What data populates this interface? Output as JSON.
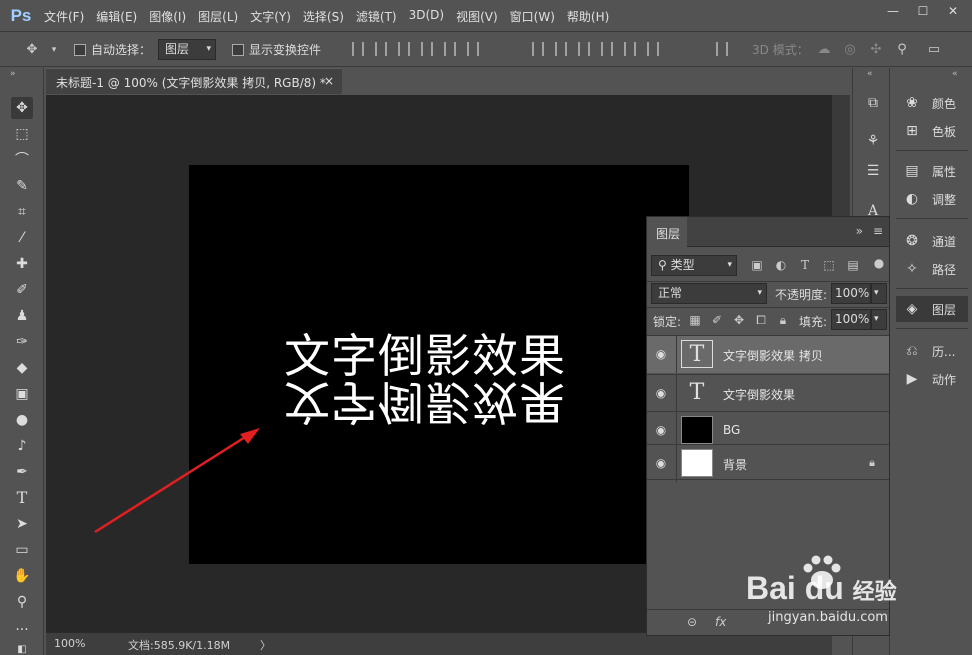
{
  "app": {
    "logo": "Ps"
  },
  "menus": [
    "文件(F)",
    "编辑(E)",
    "图像(I)",
    "图层(L)",
    "文字(Y)",
    "选择(S)",
    "滤镜(T)",
    "3D(D)",
    "视图(V)",
    "窗口(W)",
    "帮助(H)"
  ],
  "window_controls": {
    "minimize": "—",
    "maximize": "☐",
    "close": "✕"
  },
  "options": {
    "auto_select_label": "自动选择：",
    "auto_select_value": "图层",
    "show_transform_label": "显示变换控件",
    "mode_3d_label": "3D 模式："
  },
  "document": {
    "tab_title": "未标题-1 @ 100% (文字倒影效果 拷贝, RGB/8) *",
    "close": "×",
    "canvas_text": "文字倒影效果",
    "reflection_text": "文字倒影效果"
  },
  "status": {
    "zoom": "100%",
    "doc_info": "文档:585.9K/1.18M",
    "arrow": "〉"
  },
  "side_panels": [
    {
      "icon": "palette-icon",
      "label": "颜色"
    },
    {
      "icon": "swatches-icon",
      "label": "色板"
    },
    {
      "icon": "properties-icon",
      "label": "属性"
    },
    {
      "icon": "adjustments-icon",
      "label": "调整"
    },
    {
      "icon": "channels-icon",
      "label": "通道"
    },
    {
      "icon": "paths-icon",
      "label": "路径"
    },
    {
      "icon": "layers-icon",
      "label": "图层"
    },
    {
      "icon": "history-icon",
      "label": "历..."
    },
    {
      "icon": "actions-icon",
      "label": "动作"
    }
  ],
  "layers_panel": {
    "tab": "图层",
    "filter_label": "类型",
    "blend_mode": "正常",
    "opacity_label": "不透明度:",
    "opacity_value": "100%",
    "lock_label": "锁定:",
    "fill_label": "填充:",
    "fill_value": "100%",
    "layers": [
      {
        "name": "文字倒影效果 拷贝",
        "type": "text",
        "selected": true
      },
      {
        "name": "文字倒影效果",
        "type": "text",
        "selected": false
      },
      {
        "name": "BG",
        "type": "black",
        "selected": false
      },
      {
        "name": "背景",
        "type": "white",
        "selected": false,
        "locked": true
      }
    ],
    "footer": {
      "link": "⊝",
      "fx": "fx"
    }
  },
  "watermark": {
    "brand": "Bai  du",
    "cn": "经验",
    "url": "jingyan.baidu.com"
  },
  "colors": {
    "panel": "#535353",
    "workspace": "#282828",
    "arrow": "#e02020"
  }
}
